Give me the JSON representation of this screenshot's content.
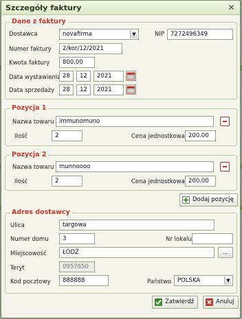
{
  "window": {
    "title": "Szczegóły faktury",
    "close_glyph": "✕"
  },
  "invoice": {
    "legend": "Dane z faktury",
    "supplier_label": "Dostawca",
    "supplier_value": "novafirma",
    "nip_label": "NIP",
    "nip_value": "7272496349",
    "number_label": "Numer faktury",
    "number_value": "2/kor/12/2021",
    "amount_label": "Kwota faktury",
    "amount_value": "800.00",
    "issue_date_label": "Data wystawienia",
    "issue_day": "28",
    "issue_month": "12",
    "issue_year": "2021",
    "sale_date_label": "Data sprzedaży",
    "sale_day": "28",
    "sale_month": "12",
    "sale_year": "2021"
  },
  "positions": [
    {
      "legend": "Pozycja 1",
      "name_label": "Nazwa towaru",
      "name_value": "immunomuno",
      "qty_label": "Ilość",
      "qty_value": "2",
      "price_label": "Cena jednostkowa",
      "price_value": "200.00"
    },
    {
      "legend": "Pozycja 2",
      "name_label": "Nazwa towaru",
      "name_value": "munnoooo",
      "qty_label": "Ilość",
      "qty_value": "2",
      "price_label": "Cena jednostkowa",
      "price_value": "200.00"
    }
  ],
  "add_position_label": "Dodaj pozycję",
  "address": {
    "legend": "Adres dostawcy",
    "street_label": "Ulica",
    "street_value": "targowa",
    "house_label": "Numer domu",
    "house_value": "3",
    "local_label": "Nr lokalu",
    "local_value": "",
    "city_label": "Miejscowość",
    "city_value": "ŁÓDŹ",
    "dots_label": "...",
    "teryt_label": "Teryt",
    "teryt_value": "0957650",
    "postal_label": "Kod pocztowy",
    "postal_value": "888888",
    "country_label": "Państwo",
    "country_value": "POLSKA"
  },
  "buttons": {
    "confirm": "Zatwierdź",
    "cancel": "Anuluj"
  },
  "colors": {
    "legend_red": "#c0392b",
    "confirm_green": "#3d8b2f",
    "cancel_red": "#c0392b"
  }
}
